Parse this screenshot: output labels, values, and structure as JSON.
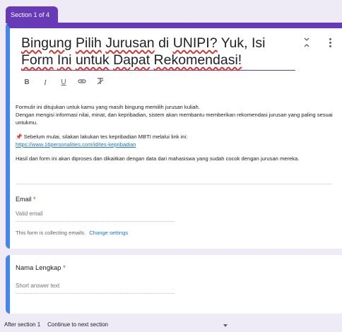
{
  "section_tab": "Section 1 of 4",
  "form": {
    "title_words": [
      "Bingung",
      "Pilih",
      "Jurusan",
      "di",
      "UNIPI?",
      "Yuk,",
      "Isi",
      "Form",
      "Ini",
      "untuk",
      "Dapat",
      "Rekomendasi!"
    ],
    "description": {
      "line1": "Formulir ini ditujukan untuk kamu yang masih bingung memilih jurusan kuliah.",
      "line2": "Dengan mengisi informasi nilai, minat, dan kepribadian, sistem akan membantu memberikan rekomendasi jurusan yang paling sesuai untukmu.",
      "mbti_text": "Sebelum mulai, silakan lakukan tes kepribadian MBTI melalui link ini:",
      "mbti_link": "https://www.16personalities.com/id/tes-kepribadian",
      "closing": "Hasil dari form ini akan diproses dan dikaitkan dengan data dari mahasiswa yang sudah cocok dengan jurusan mereka."
    }
  },
  "toolbar": {
    "bold": "B",
    "italic": "I",
    "underline": "U",
    "link": "⊖",
    "clear": "T̸"
  },
  "email": {
    "label": "Email",
    "required_mark": "*",
    "placeholder": "Valid email",
    "collecting_text": "This form is collecting emails.",
    "change_link": "Change settings"
  },
  "question": {
    "label": "Nama Lengkap",
    "required_mark": "*",
    "placeholder": "Short answer text"
  },
  "after_section": {
    "label": "After section 1",
    "value": "Continue to next section"
  },
  "icons": {
    "collapse": "collapse-icon",
    "more": "more-vert-icon",
    "pin": "📌",
    "dropdown": "dropdown-arrow-icon"
  },
  "colors": {
    "accent": "#673ab7",
    "active_border": "#4285f4",
    "link": "#1a73e8",
    "required": "#d93025"
  }
}
